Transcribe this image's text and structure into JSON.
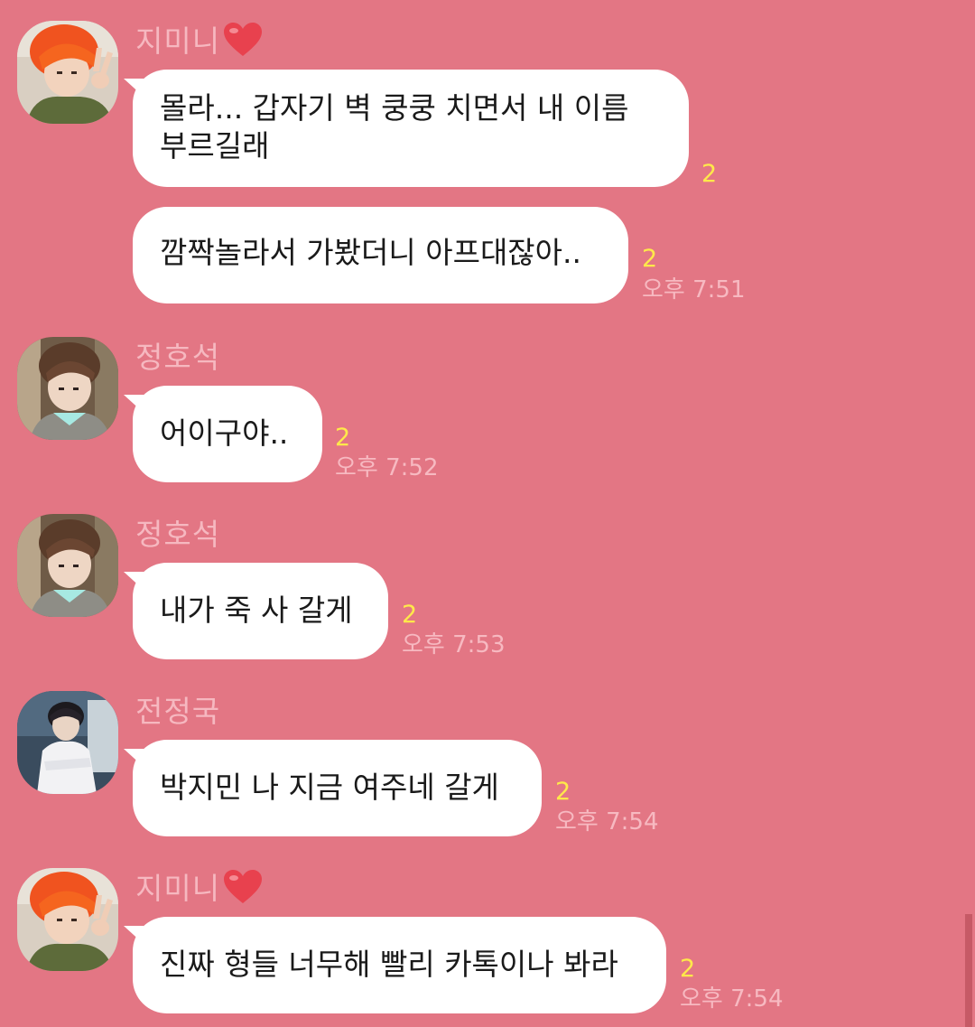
{
  "messages": [
    {
      "sender": "지미니",
      "sender_has_heart": true,
      "avatar": "orange-hair-peace-sign-avatar",
      "bubbles": [
        {
          "lines": [
            "몰라... 갑자기 벽 쿵쿵 치면서 내 이름",
            "부르길래"
          ],
          "unread": "2",
          "time": ""
        },
        {
          "lines": [
            "깜짝놀라서 가봤더니 아프대잖아.."
          ],
          "unread": "2",
          "time": "오후 7:51"
        }
      ]
    },
    {
      "sender": "정호석",
      "sender_has_heart": false,
      "avatar": "brown-hair-selfie-avatar",
      "bubbles": [
        {
          "lines": [
            "어이구야.."
          ],
          "unread": "2",
          "time": "오후 7:52"
        }
      ]
    },
    {
      "sender": "정호석",
      "sender_has_heart": false,
      "avatar": "brown-hair-selfie-avatar",
      "bubbles": [
        {
          "lines": [
            "내가 죽 사 갈게"
          ],
          "unread": "2",
          "time": "오후 7:53"
        }
      ]
    },
    {
      "sender": "전정국",
      "sender_has_heart": false,
      "avatar": "white-shirt-portrait-avatar",
      "bubbles": [
        {
          "lines": [
            "박지민 나 지금 여주네 갈게"
          ],
          "unread": "2",
          "time": "오후 7:54"
        }
      ]
    },
    {
      "sender": "지미니",
      "sender_has_heart": true,
      "avatar": "orange-hair-peace-sign-avatar",
      "bubbles": [
        {
          "lines": [
            "진짜 형들 너무해 빨리 카톡이나 봐라"
          ],
          "unread": "2",
          "time": "오후 7:54"
        }
      ]
    }
  ],
  "colors": {
    "background": "#e37684",
    "bubble": "#ffffff",
    "sender_name": "#f6b8c0",
    "unread_count": "#ffe94a",
    "timestamp": "#f7b9c1",
    "heart": "#e8414e"
  }
}
